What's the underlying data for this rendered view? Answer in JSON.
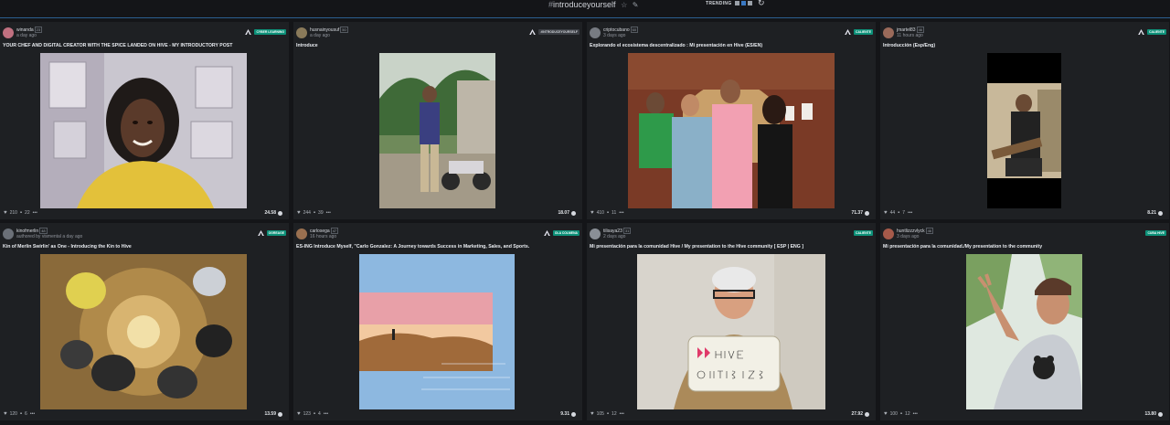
{
  "header": {
    "tag": "introduceyourself",
    "hash": "#",
    "star_icon": "☆",
    "edit_icon": "✎",
    "trending_label": "TRENDING",
    "refresh_icon": "↻"
  },
  "colors": {
    "accent": "#2b5f8f",
    "badge_green": "#0d9179",
    "badge_dark": "#3b3e44",
    "card_bg": "#1e2023"
  },
  "posts": [
    {
      "author": "winanda",
      "rep": "23",
      "time": "a day ago",
      "community": "Cyber Learning",
      "badge_style": "green",
      "title": "YOUR CHEF AND DIGITAL CREATOR WITH THE SPICE LANDED ON HIVE - MY INTRODUCTORY POST",
      "votes": "210",
      "comments": "22",
      "payout": "24.58",
      "avatar_color": "#c07080"
    },
    {
      "author": "husnainyousuf",
      "rep": "50",
      "time": "a day ago",
      "community": "#introduceyourself",
      "badge_style": "dark",
      "title": "Introduce",
      "votes": "244",
      "comments": "39",
      "payout": "18.07",
      "avatar_color": "#8a7a5a"
    },
    {
      "author": "criptocubano",
      "rep": "60",
      "time": "3 days ago",
      "community": "Caliente",
      "badge_style": "green",
      "title": "Explorando el ecosistema descentralizado : Mi presentación en Hive (ES/EN)",
      "votes": "410",
      "comments": "11",
      "payout": "71.37",
      "avatar_color": "#777b82"
    },
    {
      "author": "jmartel83",
      "rep": "46",
      "time": "11 hours ago",
      "community": "Caliente",
      "badge_style": "green",
      "title": "Introducción (Esp/Eng)",
      "votes": "44",
      "comments": "7",
      "payout": "8.21",
      "avatar_color": "#9a6a5a"
    },
    {
      "author": "kinofmerlin",
      "rep": "48",
      "time": "a day ago",
      "authored_by": "authored by",
      "co_author": "vismental",
      "community": "Ogreage",
      "badge_style": "green",
      "title": "Kin of Merlin Swirlin' as One - Introducing the Kin to Hive",
      "votes": "120",
      "comments": "6",
      "payout": "13.59",
      "avatar_color": "#6b7078"
    },
    {
      "author": "carlosega",
      "rep": "47",
      "time": "16 hours ago",
      "community": "Ola Colmena",
      "badge_style": "green",
      "title": "ES-ING Introduce Myself, \"Carlo Gonzalez: A Journey towards Success in Marketing, Sales, and Sports.",
      "votes": "123",
      "comments": "4",
      "payout": "9.31",
      "avatar_color": "#9a7050"
    },
    {
      "author": "tilisaya23",
      "rep": "31",
      "time": "2 days ago",
      "community": "Caliente",
      "badge_style": "green",
      "title": "Mi presentación para la comunidad Hive / My presentation to the Hive community [ ESP | ENG ]",
      "votes": "105",
      "comments": "12",
      "payout": "27.92",
      "avatar_color": "#8a8f96"
    },
    {
      "author": "huntlizzzvlyck",
      "rep": "46",
      "time": "3 days ago",
      "community": "Cuba Hive",
      "badge_style": "green",
      "title": "Mi presentación para la comunidad./My presentation to the community",
      "votes": "100",
      "comments": "12",
      "payout": "13.80",
      "avatar_color": "#a65a4a"
    }
  ]
}
